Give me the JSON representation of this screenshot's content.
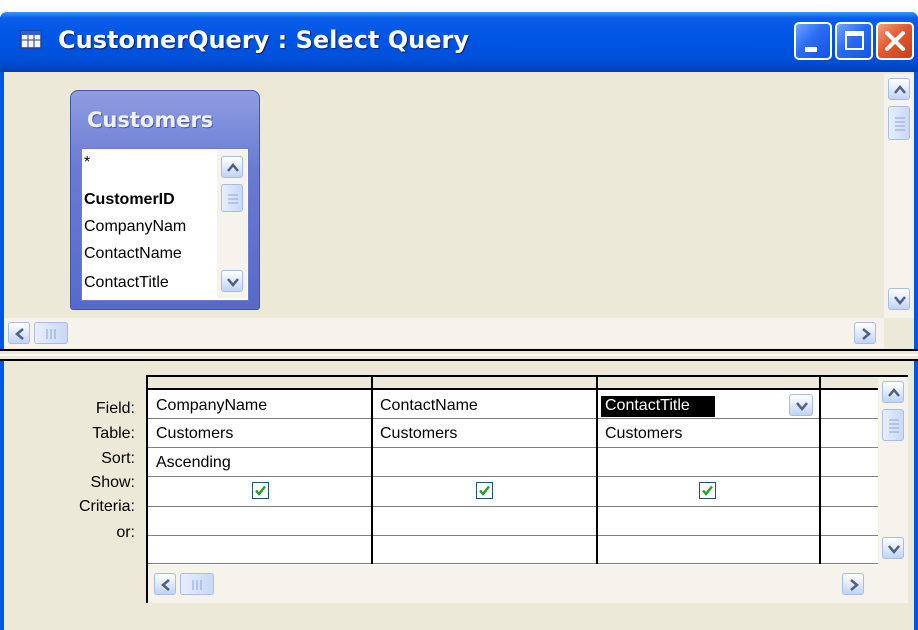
{
  "window": {
    "title": "CustomerQuery : Select Query",
    "accent": "#0055e5",
    "close_color": "#e3582f"
  },
  "field_list": {
    "table_name": "Customers",
    "fields": [
      "*",
      "CustomerID",
      "CompanyNam",
      "ContactName",
      "ContactTitle"
    ],
    "primary_key": "CustomerID"
  },
  "grid": {
    "row_labels": [
      "Field:",
      "Table:",
      "Sort:",
      "Show:",
      "Criteria:",
      "or:"
    ],
    "columns": [
      {
        "field": "CompanyName",
        "table": "Customers",
        "sort": "Ascending",
        "show": true
      },
      {
        "field": "ContactName",
        "table": "Customers",
        "sort": "",
        "show": true
      },
      {
        "field": "ContactTitle",
        "table": "Customers",
        "sort": "",
        "show": true,
        "selected": true
      }
    ]
  },
  "icons": {
    "window_icon": "query-window-icon",
    "dropdown": "chevron-down-icon",
    "checkmark": "checkmark-icon"
  }
}
